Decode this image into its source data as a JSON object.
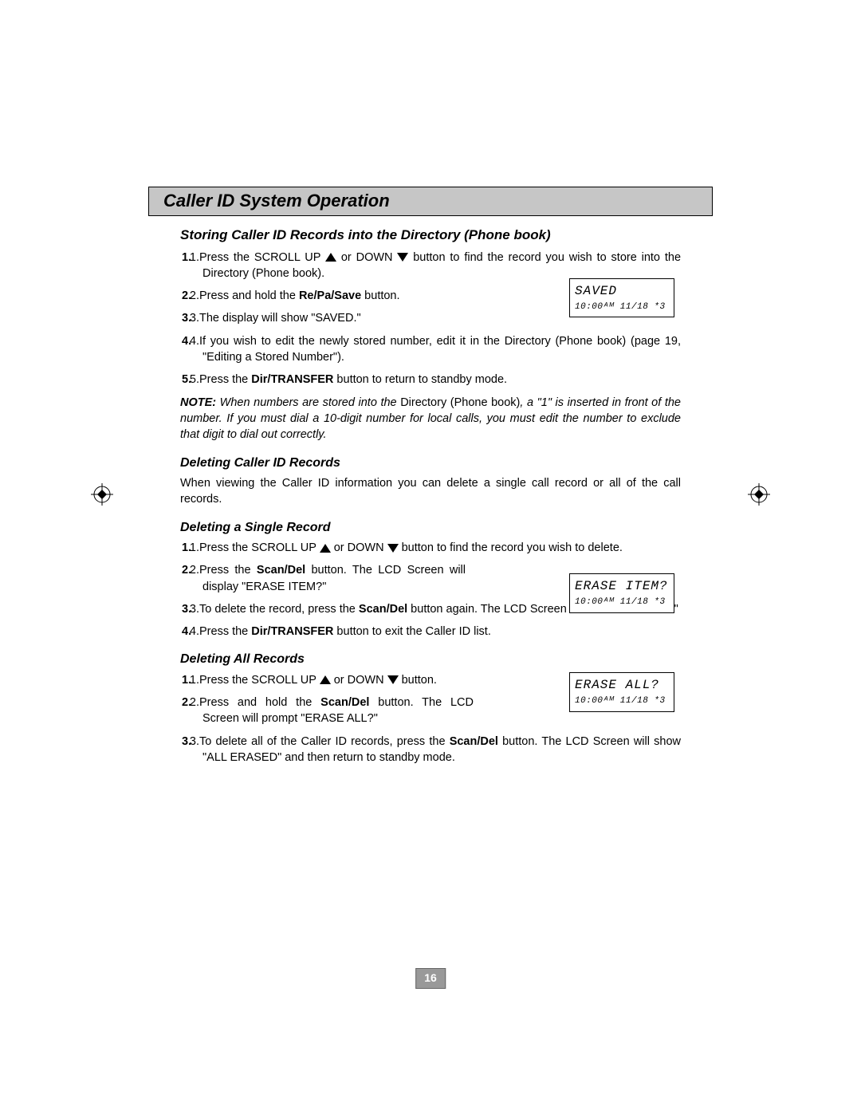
{
  "title": "Caller ID System Operation",
  "s1": {
    "h": "Storing Caller ID Records into the Directory (Phone book)",
    "i1a": "Press the SCROLL UP ",
    "i1b": " or DOWN ",
    "i1c": " button to find the record you wish to store into the Directory (Phone book).",
    "i2a": "Press and hold the ",
    "i2b": "Re/Pa/Save",
    "i2c": " button.",
    "i3": "The display will show \"SAVED.\"",
    "i4": "If you wish to edit the newly stored number, edit it in the Directory (Phone book) (page 19, \"Editing a Stored Number\").",
    "i5a": "Press the ",
    "i5b": "Dir/TRANSFER",
    "i5c": " button to return to standby mode.",
    "note_b": "NOTE:",
    "note_i1": " When numbers are stored into the ",
    "note_p": "Directory (Phone book)",
    "note_i2": ", a \"1\" is  inserted in front of the number. If you must dial a 10-digit number for local calls, you must edit the number to exclude that digit to dial out correctly.",
    "lcd1": "SAVED",
    "lcd1b": "10:00ᴬᴹ 11/18  *3"
  },
  "s2": {
    "h": "Deleting Caller ID Records",
    "p": "When viewing the Caller ID information you can delete a single call record or all of the call records."
  },
  "s3": {
    "h": "Deleting a Single Record",
    "i1a": "Press the SCROLL UP ",
    "i1b": " or DOWN ",
    "i1c": " button to find the record you wish to delete.",
    "i2a": "Press the ",
    "i2b": "Scan/Del",
    "i2c": " button. The LCD Screen will display  \"ERASE ITEM?\"",
    "i3a": "To delete the record, press the ",
    "i3b": "Scan/Del",
    "i3c": " button again. The LCD Screen will show  \"ERASED.\"",
    "i4a": "Press the ",
    "i4b": "Dir/TRANSFER",
    "i4c": " button to exit the Caller ID list.",
    "lcd1": "ERASE ITEM?",
    "lcd1b": "10:00ᴬᴹ 11/18  *3"
  },
  "s4": {
    "h": "Deleting All Records",
    "i1a": "Press the  SCROLL UP ",
    "i1b": " or DOWN ",
    "i1c": " button.",
    "i2a": "Press and hold the ",
    "i2b": "Scan/Del",
    "i2c": " button. The LCD Screen will prompt  \"ERASE ALL?\"",
    "i3a": "To delete all of the Caller ID records, press the ",
    "i3b": "Scan/Del",
    "i3c": " button. The LCD Screen will show  \"ALL ERASED\"  and then return to standby mode.",
    "lcd1": "ERASE ALL?",
    "lcd1b": "10:00ᴬᴹ 11/18  *3"
  },
  "page": "16"
}
